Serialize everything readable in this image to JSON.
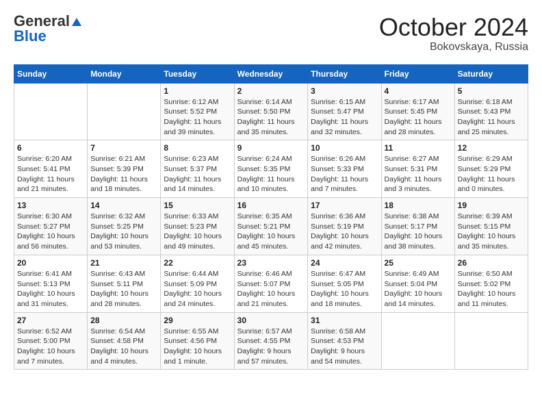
{
  "header": {
    "logo_general": "General",
    "logo_blue": "Blue",
    "month": "October 2024",
    "location": "Bokovskaya, Russia"
  },
  "weekdays": [
    "Sunday",
    "Monday",
    "Tuesday",
    "Wednesday",
    "Thursday",
    "Friday",
    "Saturday"
  ],
  "weeks": [
    [
      {
        "day": "",
        "sunrise": "",
        "sunset": "",
        "daylight": ""
      },
      {
        "day": "",
        "sunrise": "",
        "sunset": "",
        "daylight": ""
      },
      {
        "day": "1",
        "sunrise": "Sunrise: 6:12 AM",
        "sunset": "Sunset: 5:52 PM",
        "daylight": "Daylight: 11 hours and 39 minutes."
      },
      {
        "day": "2",
        "sunrise": "Sunrise: 6:14 AM",
        "sunset": "Sunset: 5:50 PM",
        "daylight": "Daylight: 11 hours and 35 minutes."
      },
      {
        "day": "3",
        "sunrise": "Sunrise: 6:15 AM",
        "sunset": "Sunset: 5:47 PM",
        "daylight": "Daylight: 11 hours and 32 minutes."
      },
      {
        "day": "4",
        "sunrise": "Sunrise: 6:17 AM",
        "sunset": "Sunset: 5:45 PM",
        "daylight": "Daylight: 11 hours and 28 minutes."
      },
      {
        "day": "5",
        "sunrise": "Sunrise: 6:18 AM",
        "sunset": "Sunset: 5:43 PM",
        "daylight": "Daylight: 11 hours and 25 minutes."
      }
    ],
    [
      {
        "day": "6",
        "sunrise": "Sunrise: 6:20 AM",
        "sunset": "Sunset: 5:41 PM",
        "daylight": "Daylight: 11 hours and 21 minutes."
      },
      {
        "day": "7",
        "sunrise": "Sunrise: 6:21 AM",
        "sunset": "Sunset: 5:39 PM",
        "daylight": "Daylight: 11 hours and 18 minutes."
      },
      {
        "day": "8",
        "sunrise": "Sunrise: 6:23 AM",
        "sunset": "Sunset: 5:37 PM",
        "daylight": "Daylight: 11 hours and 14 minutes."
      },
      {
        "day": "9",
        "sunrise": "Sunrise: 6:24 AM",
        "sunset": "Sunset: 5:35 PM",
        "daylight": "Daylight: 11 hours and 10 minutes."
      },
      {
        "day": "10",
        "sunrise": "Sunrise: 6:26 AM",
        "sunset": "Sunset: 5:33 PM",
        "daylight": "Daylight: 11 hours and 7 minutes."
      },
      {
        "day": "11",
        "sunrise": "Sunrise: 6:27 AM",
        "sunset": "Sunset: 5:31 PM",
        "daylight": "Daylight: 11 hours and 3 minutes."
      },
      {
        "day": "12",
        "sunrise": "Sunrise: 6:29 AM",
        "sunset": "Sunset: 5:29 PM",
        "daylight": "Daylight: 11 hours and 0 minutes."
      }
    ],
    [
      {
        "day": "13",
        "sunrise": "Sunrise: 6:30 AM",
        "sunset": "Sunset: 5:27 PM",
        "daylight": "Daylight: 10 hours and 56 minutes."
      },
      {
        "day": "14",
        "sunrise": "Sunrise: 6:32 AM",
        "sunset": "Sunset: 5:25 PM",
        "daylight": "Daylight: 10 hours and 53 minutes."
      },
      {
        "day": "15",
        "sunrise": "Sunrise: 6:33 AM",
        "sunset": "Sunset: 5:23 PM",
        "daylight": "Daylight: 10 hours and 49 minutes."
      },
      {
        "day": "16",
        "sunrise": "Sunrise: 6:35 AM",
        "sunset": "Sunset: 5:21 PM",
        "daylight": "Daylight: 10 hours and 45 minutes."
      },
      {
        "day": "17",
        "sunrise": "Sunrise: 6:36 AM",
        "sunset": "Sunset: 5:19 PM",
        "daylight": "Daylight: 10 hours and 42 minutes."
      },
      {
        "day": "18",
        "sunrise": "Sunrise: 6:38 AM",
        "sunset": "Sunset: 5:17 PM",
        "daylight": "Daylight: 10 hours and 38 minutes."
      },
      {
        "day": "19",
        "sunrise": "Sunrise: 6:39 AM",
        "sunset": "Sunset: 5:15 PM",
        "daylight": "Daylight: 10 hours and 35 minutes."
      }
    ],
    [
      {
        "day": "20",
        "sunrise": "Sunrise: 6:41 AM",
        "sunset": "Sunset: 5:13 PM",
        "daylight": "Daylight: 10 hours and 31 minutes."
      },
      {
        "day": "21",
        "sunrise": "Sunrise: 6:43 AM",
        "sunset": "Sunset: 5:11 PM",
        "daylight": "Daylight: 10 hours and 28 minutes."
      },
      {
        "day": "22",
        "sunrise": "Sunrise: 6:44 AM",
        "sunset": "Sunset: 5:09 PM",
        "daylight": "Daylight: 10 hours and 24 minutes."
      },
      {
        "day": "23",
        "sunrise": "Sunrise: 6:46 AM",
        "sunset": "Sunset: 5:07 PM",
        "daylight": "Daylight: 10 hours and 21 minutes."
      },
      {
        "day": "24",
        "sunrise": "Sunrise: 6:47 AM",
        "sunset": "Sunset: 5:05 PM",
        "daylight": "Daylight: 10 hours and 18 minutes."
      },
      {
        "day": "25",
        "sunrise": "Sunrise: 6:49 AM",
        "sunset": "Sunset: 5:04 PM",
        "daylight": "Daylight: 10 hours and 14 minutes."
      },
      {
        "day": "26",
        "sunrise": "Sunrise: 6:50 AM",
        "sunset": "Sunset: 5:02 PM",
        "daylight": "Daylight: 10 hours and 11 minutes."
      }
    ],
    [
      {
        "day": "27",
        "sunrise": "Sunrise: 6:52 AM",
        "sunset": "Sunset: 5:00 PM",
        "daylight": "Daylight: 10 hours and 7 minutes."
      },
      {
        "day": "28",
        "sunrise": "Sunrise: 6:54 AM",
        "sunset": "Sunset: 4:58 PM",
        "daylight": "Daylight: 10 hours and 4 minutes."
      },
      {
        "day": "29",
        "sunrise": "Sunrise: 6:55 AM",
        "sunset": "Sunset: 4:56 PM",
        "daylight": "Daylight: 10 hours and 1 minute."
      },
      {
        "day": "30",
        "sunrise": "Sunrise: 6:57 AM",
        "sunset": "Sunset: 4:55 PM",
        "daylight": "Daylight: 9 hours and 57 minutes."
      },
      {
        "day": "31",
        "sunrise": "Sunrise: 6:58 AM",
        "sunset": "Sunset: 4:53 PM",
        "daylight": "Daylight: 9 hours and 54 minutes."
      },
      {
        "day": "",
        "sunrise": "",
        "sunset": "",
        "daylight": ""
      },
      {
        "day": "",
        "sunrise": "",
        "sunset": "",
        "daylight": ""
      }
    ]
  ]
}
